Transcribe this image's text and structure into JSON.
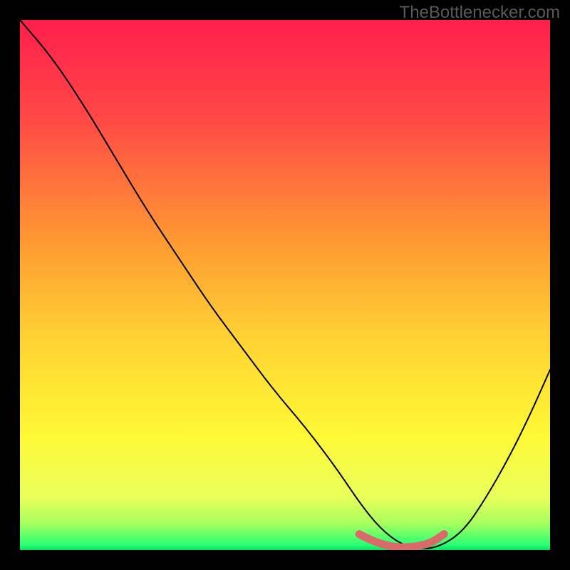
{
  "watermark": "TheBottlenecker.com",
  "chart_data": {
    "type": "line",
    "title": "",
    "xlabel": "",
    "ylabel": "",
    "xlim": [
      0,
      100
    ],
    "ylim": [
      0,
      100
    ],
    "series": [
      {
        "name": "bottleneck-curve",
        "x": [
          0,
          6,
          12,
          18,
          24,
          30,
          36,
          42,
          48,
          54,
          60,
          64,
          68,
          72,
          76,
          80,
          84,
          88,
          92,
          96,
          100
        ],
        "y": [
          100,
          93,
          84,
          74,
          64,
          55,
          46,
          38,
          30,
          23,
          15,
          9,
          4,
          1,
          0,
          1,
          4,
          10,
          17,
          25,
          34
        ]
      },
      {
        "name": "optimal-range",
        "x": [
          64,
          66,
          68,
          70,
          72,
          74,
          76,
          78,
          80
        ],
        "y": [
          3,
          2,
          1.2,
          0.7,
          0.5,
          0.6,
          0.9,
          1.6,
          3
        ]
      }
    ],
    "gradient_stops": [
      {
        "pct": 0,
        "color": "#ff1f4b"
      },
      {
        "pct": 18,
        "color": "#ff4747"
      },
      {
        "pct": 42,
        "color": "#ff9a32"
      },
      {
        "pct": 60,
        "color": "#ffd233"
      },
      {
        "pct": 78,
        "color": "#fff835"
      },
      {
        "pct": 90,
        "color": "#eaff5a"
      },
      {
        "pct": 95,
        "color": "#a6ff5e"
      },
      {
        "pct": 99,
        "color": "#2bff74"
      },
      {
        "pct": 100,
        "color": "#08e463"
      }
    ],
    "colors": {
      "curve": "#000000",
      "optimal": "#d86a6a"
    }
  }
}
